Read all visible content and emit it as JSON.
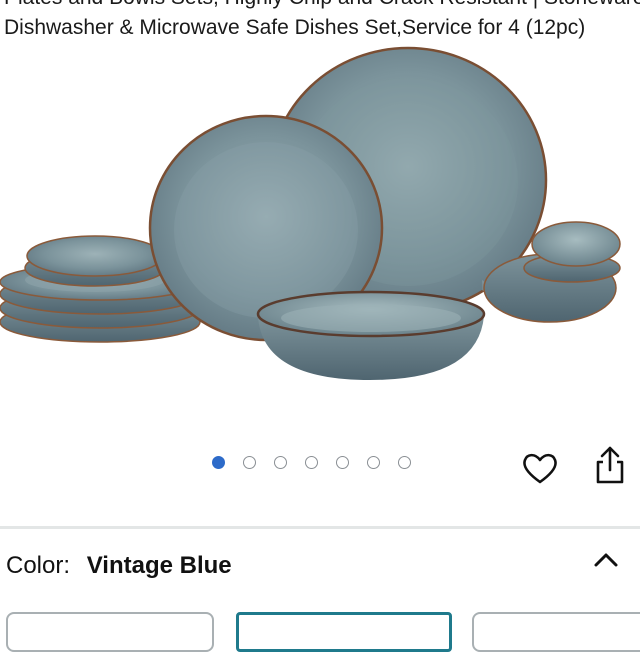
{
  "product": {
    "title_line1": "Plates and Bowls Sets, Highly Chip and Crack Resistant | Stoneware",
    "title_line2": "Dishwasher & Microwave Safe Dishes Set,Service for 4 (12pc)"
  },
  "gallery": {
    "image_alt": "12-piece blue reactive glaze stoneware dinnerware set",
    "dot_count": 7,
    "active_index": 0
  },
  "actions": {
    "favorite_icon": "heart-icon",
    "share_icon": "share-icon"
  },
  "variation": {
    "label": "Color:",
    "value": "Vintage Blue",
    "toggle_icon": "chevron-up-icon"
  },
  "colors": {
    "accent": "#2d6bc9",
    "selected_border": "#1f7a8c",
    "glaze": "#7f98a0"
  }
}
